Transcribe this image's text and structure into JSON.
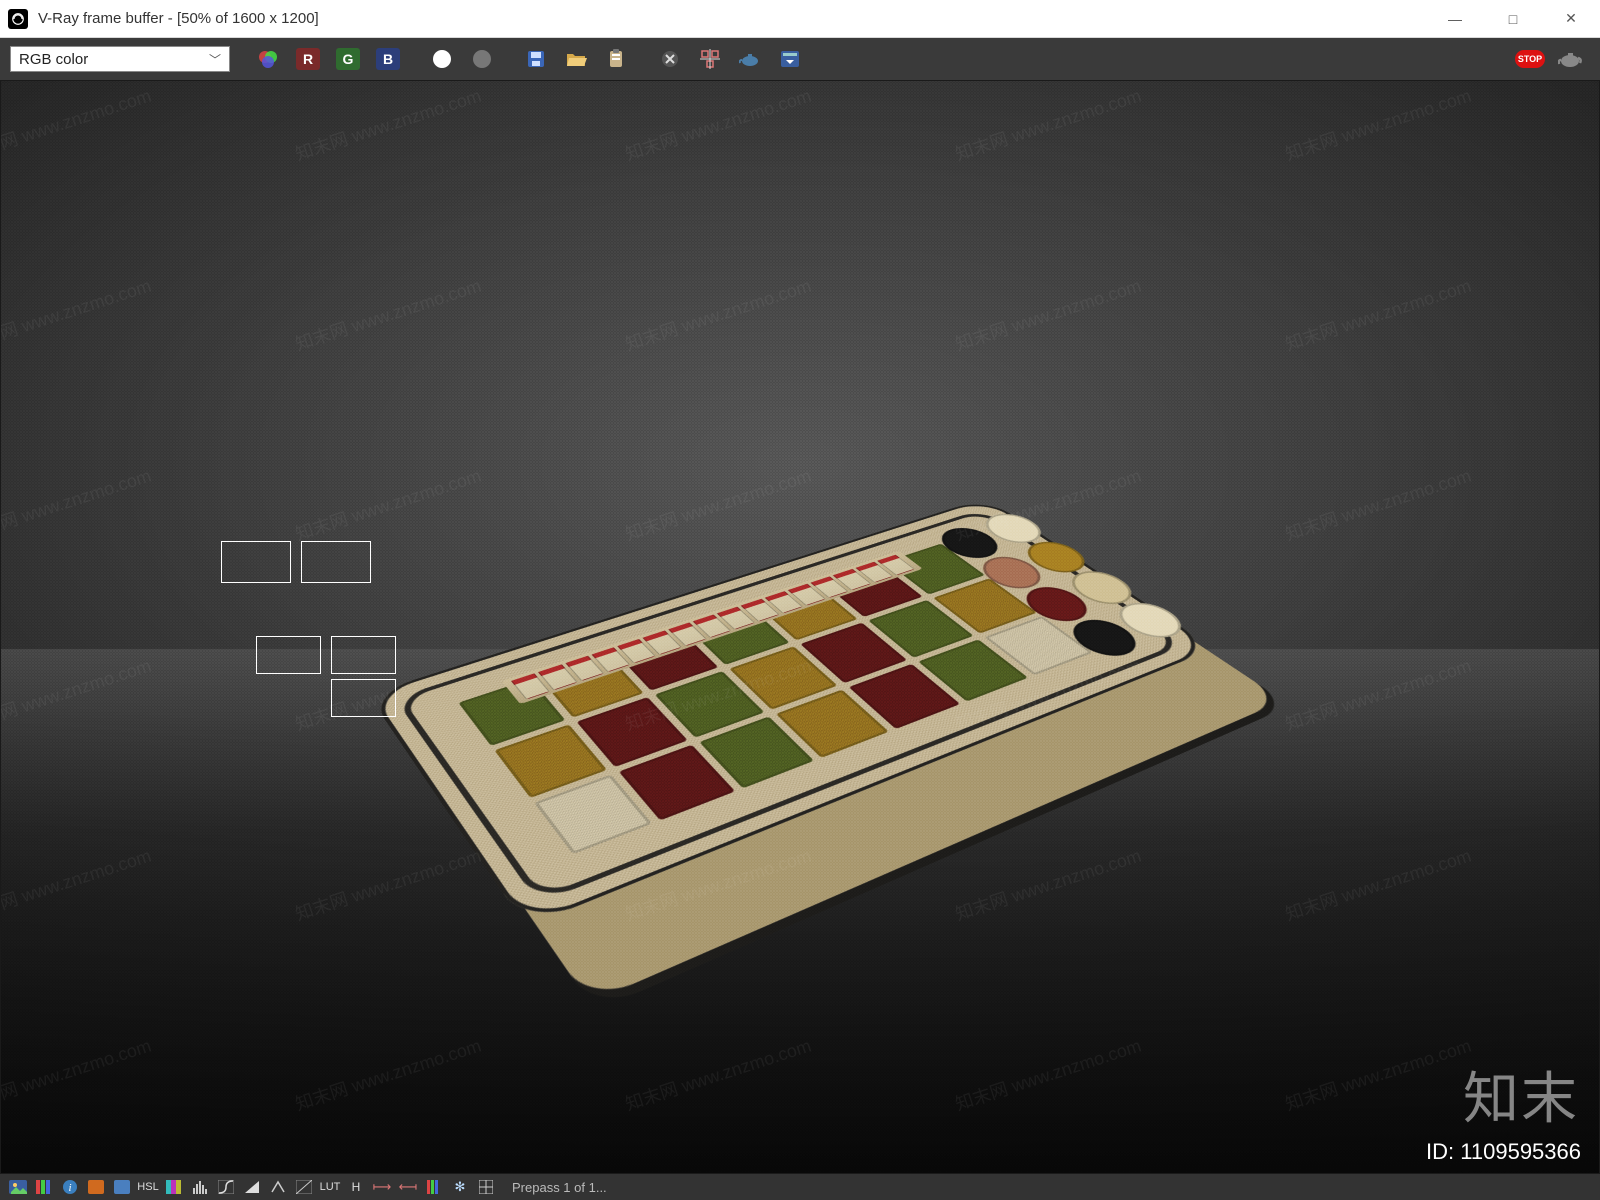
{
  "window": {
    "title": "V-Ray frame buffer - [50% of 1600 x 1200]",
    "controls": {
      "minimize": "—",
      "maximize": "□",
      "close": "✕"
    }
  },
  "toolbar": {
    "channel_label": "RGB color",
    "buttons": {
      "channels": "channels",
      "r": "R",
      "g": "G",
      "b": "B",
      "mono_white": "white",
      "mono_grey": "grey",
      "save": "save",
      "open": "open",
      "clipboard": "clipboard",
      "clear": "clear",
      "region": "region",
      "link": "link",
      "history": "history",
      "stop": "STOP",
      "teapot": "render"
    }
  },
  "render": {
    "subject": "supermarket bulk-grain display stand (3D render preview, noisy prepass)",
    "bin_colors": [
      "#6a7f2d",
      "#b7962a",
      "#7c1f1f",
      "#6a7f2d",
      "#b7962a",
      "#7c1f1f",
      "#6a7f2d",
      "#b7962a",
      "#7c1f1f",
      "#6a7f2d",
      "#b7962a",
      "#7c1f1f",
      "#6a7f2d",
      "#b7962a",
      "#e8dfc4",
      "#7c1f1f",
      "#6a7f2d",
      "#b7962a",
      "#7c1f1f",
      "#6a7f2d",
      "#e8dfc4"
    ],
    "cylinder_colors": [
      "#1b1b1b",
      "#e8dfc4",
      "#b7876a",
      "#b7962a",
      "#7c1f1f",
      "#d8cba6",
      "#1b1b1b",
      "#e8dfc4"
    ]
  },
  "watermark": {
    "repeat_text": "知末网 www.znzmo.com",
    "brand": "知末",
    "id_label": "ID: 1109595366"
  },
  "statusbar": {
    "labels": {
      "hsl": "HSL",
      "lut": "LUT",
      "h": "H"
    },
    "status_text": "Prepass 1 of 1..."
  }
}
